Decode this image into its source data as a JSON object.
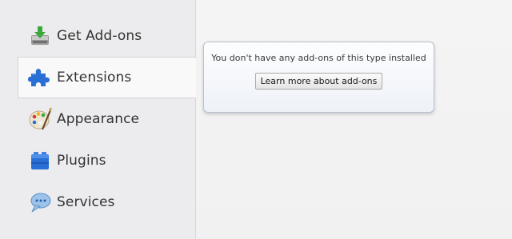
{
  "sidebar": {
    "items": [
      {
        "label": "Get Add-ons",
        "icon": "get-addons-icon",
        "selected": false
      },
      {
        "label": "Extensions",
        "icon": "puzzle-piece-icon",
        "selected": true
      },
      {
        "label": "Appearance",
        "icon": "palette-icon",
        "selected": false
      },
      {
        "label": "Plugins",
        "icon": "plugin-block-icon",
        "selected": false
      },
      {
        "label": "Services",
        "icon": "chat-bubble-icon",
        "selected": false
      }
    ]
  },
  "notice": {
    "message": "You don't have any add-ons of this type installed",
    "button_label": "Learn more about add-ons"
  },
  "colors": {
    "accent_blue": "#2a6fd6",
    "green_arrow": "#3aa83a"
  }
}
